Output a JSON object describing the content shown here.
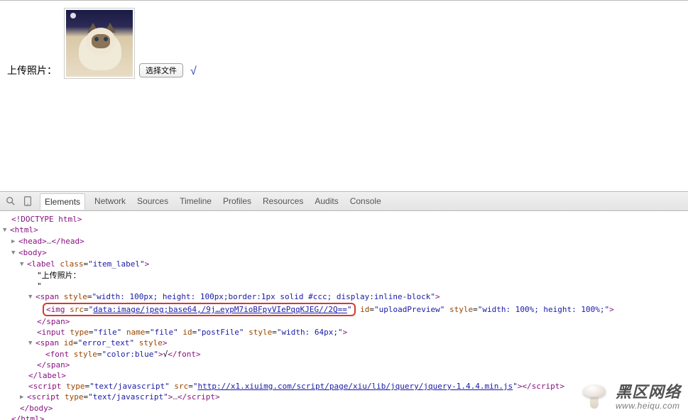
{
  "page": {
    "upload_label": "上传照片：",
    "file_button": "选择文件",
    "success_mark": "√"
  },
  "devtools": {
    "tabs": [
      "Elements",
      "Network",
      "Sources",
      "Timeline",
      "Profiles",
      "Resources",
      "Audits",
      "Console"
    ],
    "active_tab": 0
  },
  "dom": {
    "doctype": "<!DOCTYPE html>",
    "html_open": "html",
    "head": {
      "open": "head",
      "ellipsis": "…",
      "close": "head"
    },
    "body_open": "body",
    "label": {
      "tag": "label",
      "class_attr": "class",
      "class_val": "item_label",
      "text1": "\"上传照片：",
      "text2": "\""
    },
    "span_preview": {
      "tag": "span",
      "style_attr": "style",
      "style_val": "width: 100px; height: 100px;border:1px solid #ccc; display:inline-block"
    },
    "img": {
      "tag": "img",
      "src_attr": "src",
      "src_val": "data:image/jpeg;base64,/9j…eypM7ioBFpyVIePqqKJEG//2Q==",
      "id_attr": "id",
      "id_val": "uploadPreview",
      "style_attr": "style",
      "style_val": "width: 100%; height: 100%;"
    },
    "span_close": "span",
    "input": {
      "tag": "input",
      "type_attr": "type",
      "type_val": "file",
      "name_attr": "name",
      "name_val": "file",
      "id_attr": "id",
      "id_val": "postFile",
      "style_attr": "style",
      "style_val": "width: 64px;"
    },
    "error_span": {
      "tag": "span",
      "id_attr": "id",
      "id_val": "error_text",
      "style_attr": "style"
    },
    "font": {
      "tag": "font",
      "style_attr": "style",
      "style_val": "color:blue",
      "text": "√"
    },
    "label_close": "label",
    "script1": {
      "tag": "script",
      "type_attr": "type",
      "type_val": "text/javascript",
      "src_attr": "src",
      "src_val": "http://x1.xiuimg.com/script/page/xiu/lib/jquery/jquery-1.4.4.min.js"
    },
    "script2": {
      "tag": "script",
      "type_attr": "type",
      "type_val": "text/javascript",
      "ellipsis": "…"
    },
    "body_close": "body",
    "html_close": "html"
  },
  "watermark": {
    "cn": "黑区网络",
    "url": "www.heiqu.com"
  }
}
